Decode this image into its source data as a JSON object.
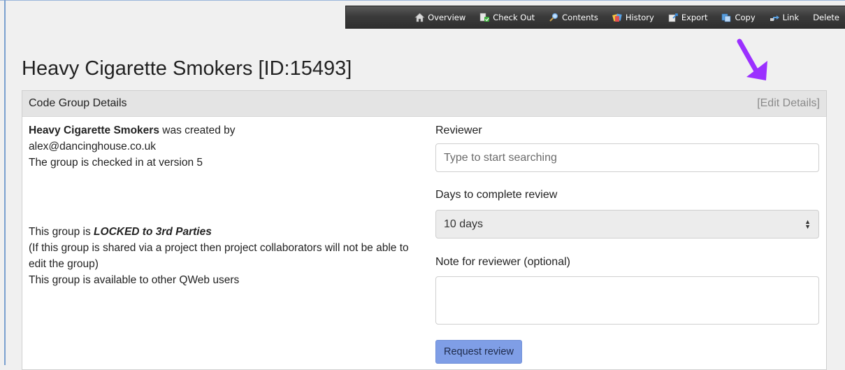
{
  "toolbar": {
    "items": [
      {
        "label": "Overview",
        "icon": "home-icon"
      },
      {
        "label": "Check Out",
        "icon": "check-out-icon"
      },
      {
        "label": "Contents",
        "icon": "magnifier-icon"
      },
      {
        "label": "History",
        "icon": "history-icon"
      },
      {
        "label": "Export",
        "icon": "export-icon"
      },
      {
        "label": "Copy",
        "icon": "copy-icon"
      },
      {
        "label": "Link",
        "icon": "link-icon"
      },
      {
        "label": "Delete",
        "icon": ""
      }
    ]
  },
  "page": {
    "title": "Heavy Cigarette Smokers [ID:15493]"
  },
  "panel": {
    "header": "Code Group Details",
    "edit_link": "[Edit Details]",
    "group_name": "Heavy Cigarette Smokers",
    "created_by_text": " was created by",
    "creator": "alex@dancinghouse.co.uk",
    "version_text": "The group is checked in at version 5",
    "locked_prefix": "This group is ",
    "locked_status": "LOCKED to 3rd Parties",
    "locked_note": "(If this group is shared via a project then project collaborators will not be able to edit the group)",
    "availability": "This group is available to other QWeb users"
  },
  "review_form": {
    "reviewer_label": "Reviewer",
    "reviewer_placeholder": "Type to start searching",
    "days_label": "Days to complete review",
    "days_selected": "10 days",
    "note_label": "Note for reviewer (optional)",
    "note_value": "",
    "submit_label": "Request review",
    "submit_color": "#7f9ee6"
  },
  "annotation": {
    "arrow_color": "#9b30ff"
  }
}
